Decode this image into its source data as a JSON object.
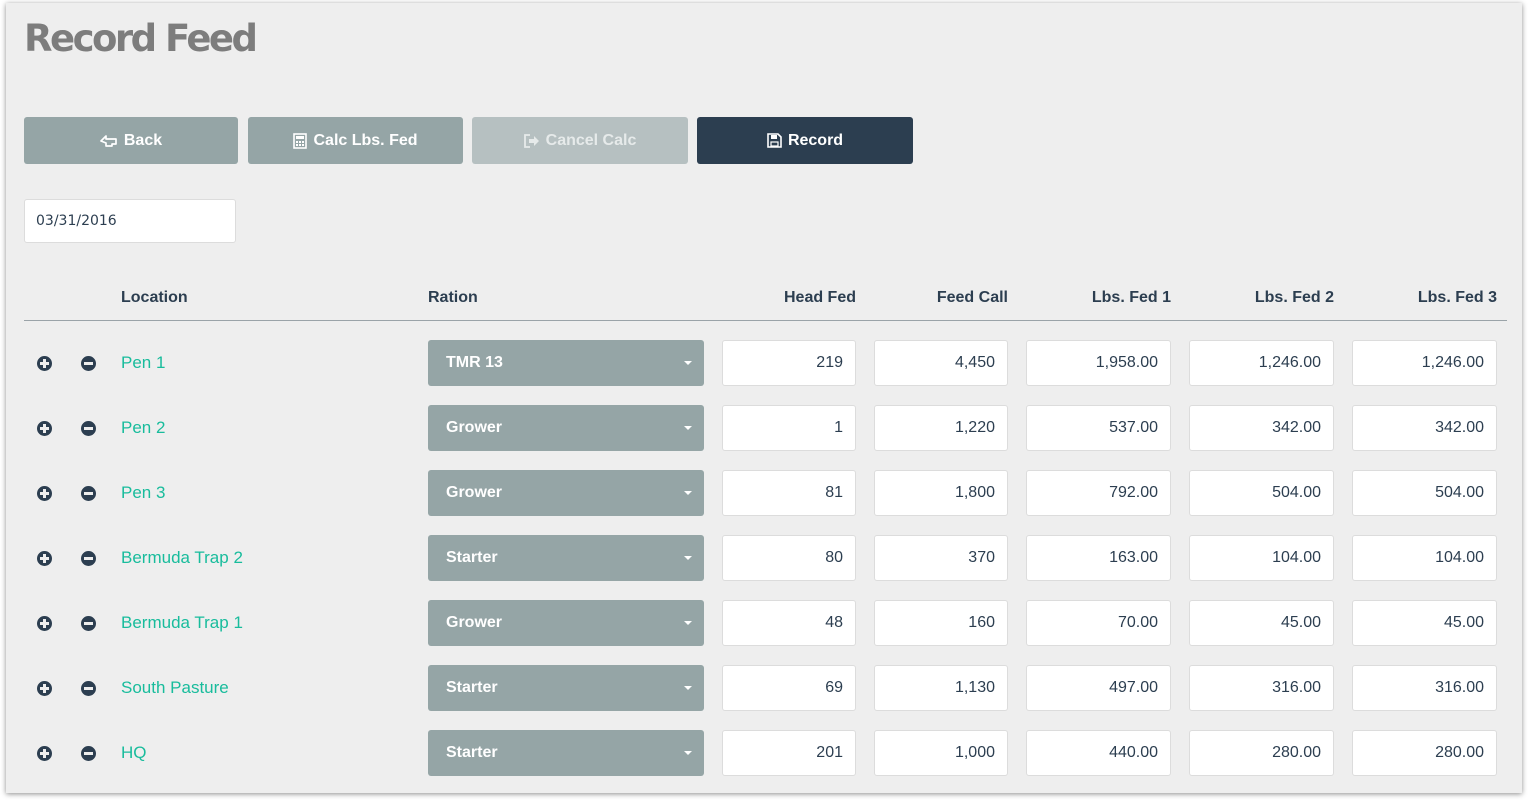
{
  "page": {
    "title": "Record Feed"
  },
  "toolbar": {
    "back_label": "Back",
    "calc_label": "Calc Lbs. Fed",
    "cancel_label": "Cancel Calc",
    "record_label": "Record"
  },
  "date": {
    "value": "03/31/2016"
  },
  "table": {
    "headers": {
      "location": "Location",
      "ration": "Ration",
      "head_fed": "Head Fed",
      "feed_call": "Feed Call",
      "lbs1": "Lbs. Fed 1",
      "lbs2": "Lbs. Fed 2",
      "lbs3": "Lbs. Fed 3"
    },
    "rows": [
      {
        "location": "Pen 1",
        "ration": "TMR 13",
        "head_fed": "219",
        "feed_call": "4,450",
        "lbs1": "1,958.00",
        "lbs2": "1,246.00",
        "lbs3": "1,246.00"
      },
      {
        "location": "Pen 2",
        "ration": "Grower",
        "head_fed": "1",
        "feed_call": "1,220",
        "lbs1": "537.00",
        "lbs2": "342.00",
        "lbs3": "342.00"
      },
      {
        "location": "Pen 3",
        "ration": "Grower",
        "head_fed": "81",
        "feed_call": "1,800",
        "lbs1": "792.00",
        "lbs2": "504.00",
        "lbs3": "504.00"
      },
      {
        "location": "Bermuda Trap 2",
        "ration": "Starter",
        "head_fed": "80",
        "feed_call": "370",
        "lbs1": "163.00",
        "lbs2": "104.00",
        "lbs3": "104.00"
      },
      {
        "location": "Bermuda Trap 1",
        "ration": "Grower",
        "head_fed": "48",
        "feed_call": "160",
        "lbs1": "70.00",
        "lbs2": "45.00",
        "lbs3": "45.00"
      },
      {
        "location": "South Pasture",
        "ration": "Starter",
        "head_fed": "69",
        "feed_call": "1,130",
        "lbs1": "497.00",
        "lbs2": "316.00",
        "lbs3": "316.00"
      },
      {
        "location": "HQ",
        "ration": "Starter",
        "head_fed": "201",
        "feed_call": "1,000",
        "lbs1": "440.00",
        "lbs2": "280.00",
        "lbs3": "280.00"
      }
    ]
  },
  "colors": {
    "panel_bg": "#eeeeee",
    "default_button": "#95a5a6",
    "primary_button": "#2c3e50",
    "link": "#18bc9c",
    "text": "#2c3e50"
  },
  "icons": {
    "back": "hand-point-left-icon",
    "calc": "calculator-icon",
    "cancel": "sign-out-icon",
    "record": "floppy-disk-icon",
    "add": "plus-circle-icon",
    "remove": "minus-circle-icon",
    "dropdown": "caret-down-icon"
  }
}
